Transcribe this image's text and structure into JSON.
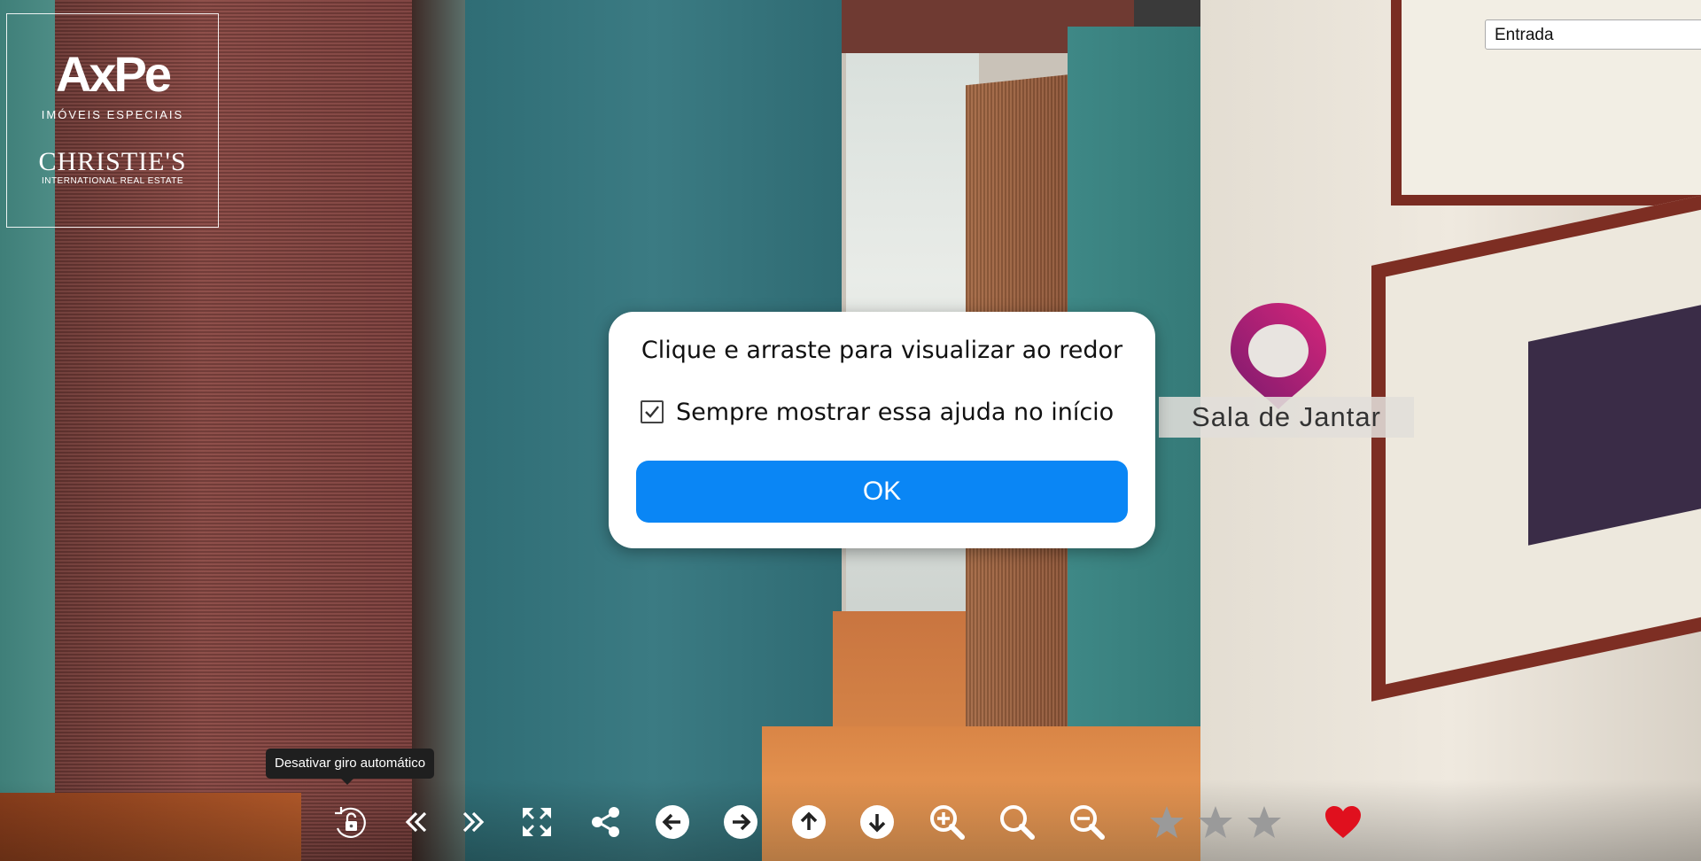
{
  "logo": {
    "brand": "AxPe",
    "subtitle": "IMÓVEIS ESPECIAIS",
    "partner": "CHRISTIE'S",
    "partner_sub": "INTERNATIONAL REAL ESTATE"
  },
  "scene_select": {
    "value": "Entrada"
  },
  "hotspot": {
    "label": "Sala de Jantar",
    "pin_color_top": "#d6267a",
    "pin_color_bottom": "#7a1a6e"
  },
  "help_dialog": {
    "message": "Clique e arraste para visualizar ao redor",
    "checkbox_label": "Sempre mostrar essa ajuda no início",
    "checkbox_checked": true,
    "ok_label": "OK",
    "ok_color": "#0a86f5"
  },
  "tooltip": {
    "text": "Desativar giro automático"
  },
  "toolbar": {
    "icons": [
      "autorotate-lock-icon",
      "previous-scene-icon",
      "next-scene-icon",
      "fullscreen-icon",
      "share-icon",
      "pan-left-icon",
      "pan-right-icon",
      "pan-up-icon",
      "pan-down-icon",
      "zoom-in-icon",
      "zoom-icon",
      "zoom-out-icon",
      "star-icon",
      "star-icon",
      "star-icon",
      "heart-icon"
    ],
    "rating": 0,
    "favorite_color": "#e0101e"
  }
}
